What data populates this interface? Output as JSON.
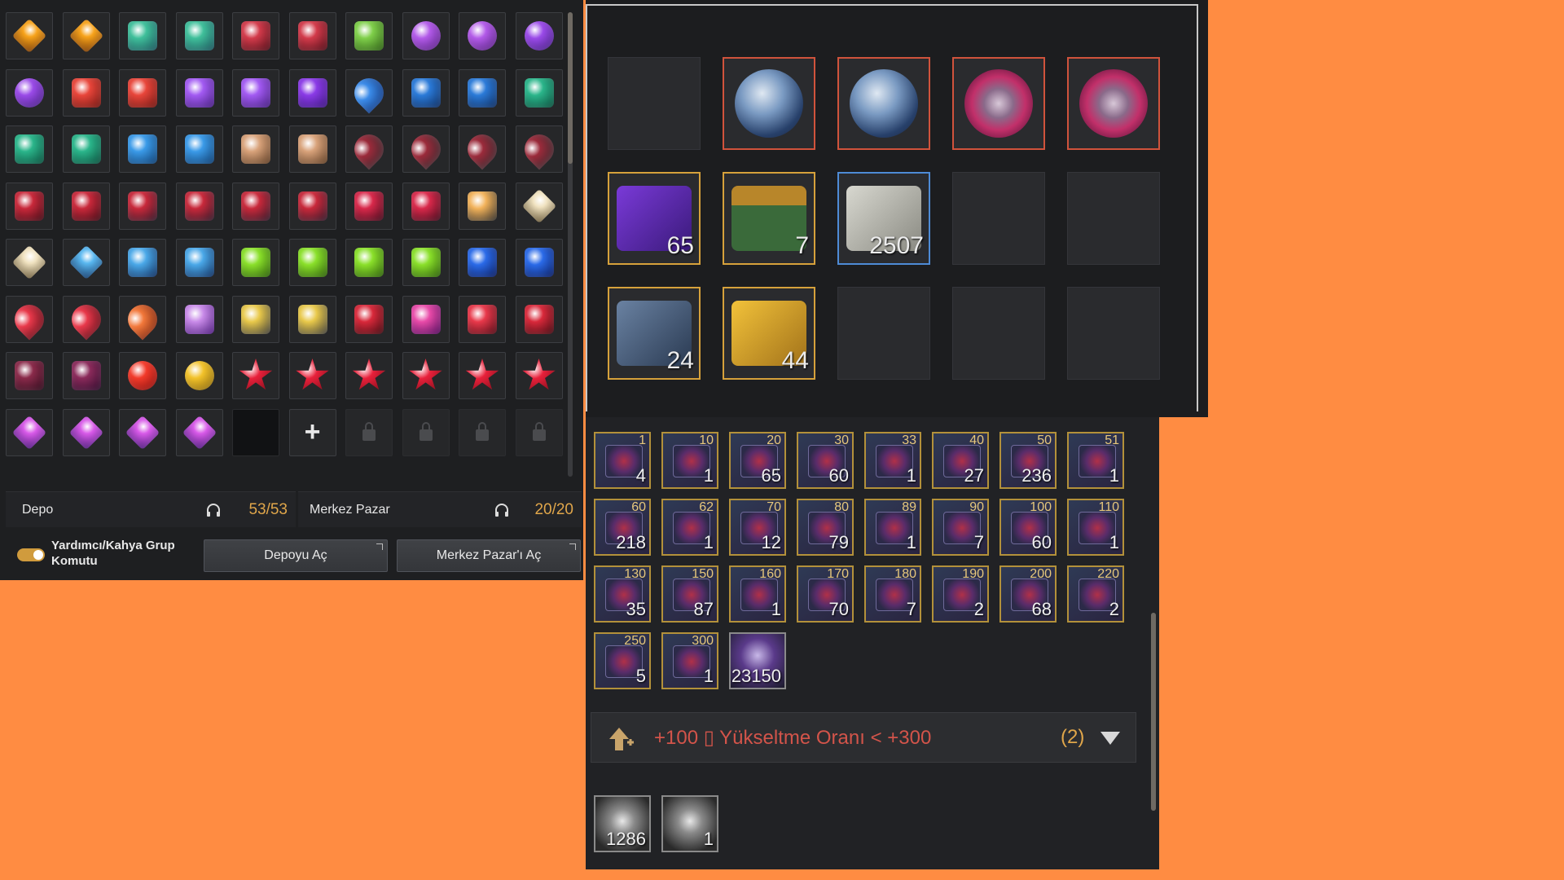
{
  "colors": {
    "accent_gold": "#e0a64a",
    "summary_red": "#d3544a",
    "background": "#ff8c42"
  },
  "inventory": {
    "slots": [
      {
        "c1": "#f7a31b",
        "c2": "#7a3b05",
        "shape": "diamond"
      },
      {
        "c1": "#f7a31b",
        "c2": "#7a3b05",
        "shape": "diamond"
      },
      {
        "c1": "#3fbf9a",
        "c2": "#1a4f5a",
        "shape": "gem"
      },
      {
        "c1": "#3fbf9a",
        "c2": "#1a4f5a",
        "shape": "gem"
      },
      {
        "c1": "#d23a4a",
        "c2": "#4a0c16",
        "shape": "gem"
      },
      {
        "c1": "#d23a4a",
        "c2": "#4a0c16",
        "shape": "gem"
      },
      {
        "c1": "#7fcf4a",
        "c2": "#2a5a12",
        "shape": "gem"
      },
      {
        "c1": "#b25ae8",
        "c2": "#4a1a72",
        "shape": "round"
      },
      {
        "c1": "#b25ae8",
        "c2": "#4a1a72",
        "shape": "round"
      },
      {
        "c1": "#9a4ae8",
        "c2": "#3a1a72",
        "shape": "round"
      },
      {
        "c1": "#9a4ae8",
        "c2": "#3a1a72",
        "shape": "round"
      },
      {
        "c1": "#e8453a",
        "c2": "#6a1410",
        "shape": "gem"
      },
      {
        "c1": "#e8453a",
        "c2": "#6a1410",
        "shape": "gem"
      },
      {
        "c1": "#a25af2",
        "c2": "#421c7a",
        "shape": "gem"
      },
      {
        "c1": "#a25af2",
        "c2": "#421c7a",
        "shape": "gem"
      },
      {
        "c1": "#8a3ae6",
        "c2": "#38147a",
        "shape": "gem"
      },
      {
        "c1": "#3a8ae8",
        "c2": "#0e2a6a",
        "shape": "drop"
      },
      {
        "c1": "#2a7ad8",
        "c2": "#0e2a5a",
        "shape": "gem"
      },
      {
        "c1": "#2a7ad8",
        "c2": "#0e2a5a",
        "shape": "gem"
      },
      {
        "c1": "#2ab58a",
        "c2": "#0a4a3a",
        "shape": "gem"
      },
      {
        "c1": "#2ab58a",
        "c2": "#0a4a3a",
        "shape": "gem"
      },
      {
        "c1": "#2ab58a",
        "c2": "#0a4a3a",
        "shape": "gem"
      },
      {
        "c1": "#3a9ae8",
        "c2": "#0e3a6a",
        "shape": "gem"
      },
      {
        "c1": "#3a9ae8",
        "c2": "#0e3a6a",
        "shape": "gem"
      },
      {
        "c1": "#d8a27a",
        "c2": "#5a3a22",
        "shape": "gem"
      },
      {
        "c1": "#d8a27a",
        "c2": "#5a3a22",
        "shape": "gem"
      },
      {
        "c1": "#9a2a3a",
        "c2": "#2a2a2e",
        "shape": "drop"
      },
      {
        "c1": "#9a2a3a",
        "c2": "#2a2a2e",
        "shape": "drop"
      },
      {
        "c1": "#9a2a3a",
        "c2": "#2a2a2e",
        "shape": "drop"
      },
      {
        "c1": "#9a2a3a",
        "c2": "#2a2a2e",
        "shape": "drop"
      },
      {
        "c1": "#c8283a",
        "c2": "#3a0a14",
        "shape": "gem"
      },
      {
        "c1": "#c8283a",
        "c2": "#3a0a14",
        "shape": "gem"
      },
      {
        "c1": "#c8283a",
        "c2": "#2a1a2a",
        "shape": "gem"
      },
      {
        "c1": "#c8283a",
        "c2": "#2a1a2a",
        "shape": "gem"
      },
      {
        "c1": "#c8283a",
        "c2": "#2a1a2a",
        "shape": "gem"
      },
      {
        "c1": "#c8283a",
        "c2": "#2a1a2a",
        "shape": "gem"
      },
      {
        "c1": "#d8284a",
        "c2": "#3a0a1a",
        "shape": "gem"
      },
      {
        "c1": "#d8284a",
        "c2": "#3a0a1a",
        "shape": "gem"
      },
      {
        "c1": "#f2b25a",
        "c2": "#2a2a2a",
        "shape": "gem"
      },
      {
        "c1": "#f0e2c0",
        "c2": "#6a5a3a",
        "shape": "diamond"
      },
      {
        "c1": "#f0e2c0",
        "c2": "#6a5a3a",
        "shape": "diamond"
      },
      {
        "c1": "#5ab8f0",
        "c2": "#143a6a",
        "shape": "diamond"
      },
      {
        "c1": "#4aa8e8",
        "c2": "#0e2a5a",
        "shape": "gem"
      },
      {
        "c1": "#4aa8e8",
        "c2": "#0e2a5a",
        "shape": "gem"
      },
      {
        "c1": "#8ae02a",
        "c2": "#2a5a0a",
        "shape": "gem"
      },
      {
        "c1": "#8ae02a",
        "c2": "#2a5a0a",
        "shape": "gem"
      },
      {
        "c1": "#8ae02a",
        "c2": "#2a5a0a",
        "shape": "gem"
      },
      {
        "c1": "#8ae02a",
        "c2": "#2a5a0a",
        "shape": "gem"
      },
      {
        "c1": "#2a6ae8",
        "c2": "#0a1a5a",
        "shape": "gem"
      },
      {
        "c1": "#2a6ae8",
        "c2": "#0a1a5a",
        "shape": "gem"
      },
      {
        "c1": "#e8384a",
        "c2": "#4a0a14",
        "shape": "drop"
      },
      {
        "c1": "#e8384a",
        "c2": "#4a0a14",
        "shape": "drop"
      },
      {
        "c1": "#f2783a",
        "c2": "#6a1a0a",
        "shape": "drop"
      },
      {
        "c1": "#c88ae8",
        "c2": "#4a1a7a",
        "shape": "gem"
      },
      {
        "c1": "#e8c84a",
        "c2": "#3a3a3a",
        "shape": "gem"
      },
      {
        "c1": "#e8c84a",
        "c2": "#3a3a3a",
        "shape": "gem"
      },
      {
        "c1": "#d8283a",
        "c2": "#3a0a10",
        "shape": "gem"
      },
      {
        "c1": "#e84aa8",
        "c2": "#4a0a5a",
        "shape": "gem"
      },
      {
        "c1": "#e8384a",
        "c2": "#4a0a14",
        "shape": "gem"
      },
      {
        "c1": "#d8283a",
        "c2": "#3a0a10",
        "shape": "gem"
      },
      {
        "c1": "#8a2a4a",
        "c2": "#2a0a1a",
        "shape": "gem"
      },
      {
        "c1": "#8a2a5a",
        "c2": "#2a0a2a",
        "shape": "gem"
      },
      {
        "c1": "#f23a2a",
        "c2": "#7a0a0a",
        "shape": "round"
      },
      {
        "c1": "#f2c22a",
        "c2": "#7a5a0a",
        "shape": "round"
      },
      {
        "c1": "#e8203a",
        "c2": "#6a0a14",
        "shape": "star"
      },
      {
        "c1": "#e8203a",
        "c2": "#6a0a14",
        "shape": "star"
      },
      {
        "c1": "#e8203a",
        "c2": "#6a0a14",
        "shape": "star"
      },
      {
        "c1": "#e8203a",
        "c2": "#6a0a14",
        "shape": "star"
      },
      {
        "c1": "#e8203a",
        "c2": "#6a0a14",
        "shape": "star"
      },
      {
        "c1": "#e8203a",
        "c2": "#6a0a14",
        "shape": "star"
      },
      {
        "c1": "#d85ae8",
        "c2": "#4a1a7a",
        "shape": "diamond"
      },
      {
        "c1": "#d85ae8",
        "c2": "#4a1a7a",
        "shape": "diamond"
      },
      {
        "c1": "#d85ae8",
        "c2": "#4a1a7a",
        "shape": "diamond"
      },
      {
        "c1": "#d85ae8",
        "c2": "#4a1a7a",
        "shape": "diamond"
      },
      {
        "kind": "empty"
      },
      {
        "kind": "plus",
        "glyph": "+"
      },
      {
        "kind": "locked"
      },
      {
        "kind": "locked"
      },
      {
        "kind": "locked"
      },
      {
        "kind": "locked"
      }
    ]
  },
  "footer": {
    "storage_label": "Depo",
    "storage_count": "53/53",
    "market_label": "Merkez Pazar",
    "market_count": "20/20",
    "toggle_label": "Yardımcı/Kahya Grup Komutu",
    "open_storage_button": "Depoyu Aç",
    "open_market_button": "Merkez Pazar'ı Aç"
  },
  "storage": {
    "slots": [
      {
        "style": "empty",
        "count": ""
      },
      {
        "style": "red",
        "art": "orb-blue",
        "count": ""
      },
      {
        "style": "red",
        "art": "orb-blue",
        "count": ""
      },
      {
        "style": "red",
        "art": "orb-pink",
        "count": ""
      },
      {
        "style": "red",
        "art": "orb-pink",
        "count": ""
      },
      {
        "style": "gold",
        "art": "scroll-purple",
        "count": "65"
      },
      {
        "style": "gold",
        "art": "chest-green",
        "count": "7"
      },
      {
        "style": "blue",
        "art": "scroll-white",
        "count": "2507"
      },
      {
        "style": "empty",
        "count": ""
      },
      {
        "style": "empty",
        "count": ""
      },
      {
        "style": "gold",
        "art": "chest-blue",
        "count": "24"
      },
      {
        "style": "gold",
        "art": "scroll-gold",
        "count": "44"
      },
      {
        "style": "empty",
        "count": ""
      },
      {
        "style": "empty",
        "count": ""
      },
      {
        "style": "empty",
        "count": ""
      }
    ]
  },
  "scrolls": {
    "items": [
      {
        "level": "1",
        "qty": "4"
      },
      {
        "level": "10",
        "qty": "1"
      },
      {
        "level": "20",
        "qty": "65"
      },
      {
        "level": "30",
        "qty": "60"
      },
      {
        "level": "33",
        "qty": "1"
      },
      {
        "level": "40",
        "qty": "27"
      },
      {
        "level": "50",
        "qty": "236"
      },
      {
        "level": "51",
        "qty": "1"
      },
      {
        "level": "60",
        "qty": "218"
      },
      {
        "level": "62",
        "qty": "1"
      },
      {
        "level": "70",
        "qty": "12"
      },
      {
        "level": "80",
        "qty": "79"
      },
      {
        "level": "89",
        "qty": "1"
      },
      {
        "level": "90",
        "qty": "7"
      },
      {
        "level": "100",
        "qty": "60"
      },
      {
        "level": "110",
        "qty": "1"
      },
      {
        "level": "130",
        "qty": "35"
      },
      {
        "level": "150",
        "qty": "87"
      },
      {
        "level": "160",
        "qty": "1"
      },
      {
        "level": "170",
        "qty": "70"
      },
      {
        "level": "180",
        "qty": "7"
      },
      {
        "level": "190",
        "qty": "2"
      },
      {
        "level": "200",
        "qty": "68"
      },
      {
        "level": "220",
        "qty": "2"
      },
      {
        "level": "250",
        "qty": "5"
      },
      {
        "level": "300",
        "qty": "1"
      },
      {
        "level": "",
        "qty": "23150",
        "special": "crystal"
      }
    ],
    "summary_text": "+100 ▯ Yükseltme Oranı < +300",
    "summary_count": "(2)",
    "extra_items": [
      {
        "qty": "1286"
      },
      {
        "qty": "1"
      }
    ]
  }
}
